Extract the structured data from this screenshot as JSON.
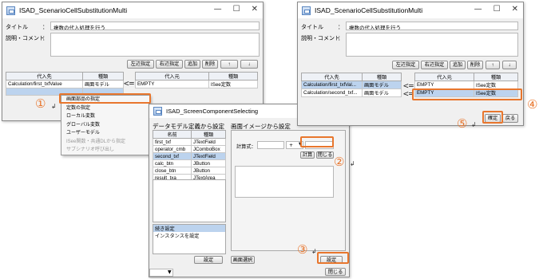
{
  "win1": {
    "title": "ISAD_ScenarioCellSubstitutionMulti",
    "title_label": "タイトル",
    "title_value": "複数の代入処理を行う",
    "comment_label": "説明・コメント",
    "colon": "：",
    "toolbar": [
      "左辺指定",
      "右辺指定",
      "追加",
      "削除",
      "↑",
      "↓"
    ],
    "left_headers": [
      "代入先",
      "種類"
    ],
    "left_rows": [
      [
        "Calculation/first_txfValue",
        "画面モデル"
      ]
    ],
    "right_headers": [
      "代入元",
      "種類"
    ],
    "right_rows": [
      [
        "EMPTY",
        "ISee定数"
      ]
    ],
    "assign_arrow": "<="
  },
  "context_menu": {
    "items": [
      "画面部品の指定",
      "定数の指定",
      "ローカル変数",
      "グローバル変数",
      "ユーザーモデル",
      "ISee関数・共通DLから指定",
      "サブシナリオ呼び出し"
    ]
  },
  "win2": {
    "title": "ISAD_ScreenComponentSelecting",
    "left_panel_title": "データモデル定義から設定",
    "list_headers": [
      "名前",
      "種類"
    ],
    "list_rows": [
      [
        "first_txf",
        "JTextField"
      ],
      [
        "operator_cmb",
        "JComboBox"
      ],
      [
        "second_txf",
        "JTextField"
      ],
      [
        "calc_btn",
        "JButton"
      ],
      [
        "close_btn",
        "JButton"
      ],
      [
        "result_txa",
        "JTextArea"
      ]
    ],
    "selected_index": 2,
    "lower_header": "続き設定",
    "lower_item": "インスタンスを設定",
    "set_label": "設定",
    "right_panel_title": "画面イメージから設定",
    "formula_label": "計算式：",
    "formula_value": "",
    "op_value": "+",
    "calc_btn": "計算",
    "close_btn": "閉じる",
    "screen_select_btn": "画面選択",
    "set_btn": "設定",
    "close_bottom_btn": "閉じる"
  },
  "win3": {
    "title": "ISAD_ScenarioCellSubstitutionMulti",
    "title_label": "タイトル",
    "title_value": "複数の代入処理を行う",
    "comment_label": "説明・コメント",
    "colon": "：",
    "toolbar": [
      "左辺指定",
      "右辺指定",
      "追加",
      "削除",
      "↑",
      "↓"
    ],
    "left_headers": [
      "代入先",
      "種類"
    ],
    "left_rows": [
      [
        "Calculation/first_txfVal...",
        "画面モデル"
      ],
      [
        "Calculation/second_txf...",
        "画面モデル"
      ]
    ],
    "right_headers": [
      "代入元",
      "種類"
    ],
    "right_rows": [
      [
        "EMPTY",
        "ISee定数"
      ],
      [
        "EMPTY",
        "ISee定数"
      ]
    ],
    "assign_arrow": "<=",
    "ok_btn": "確定",
    "back_btn": "戻る"
  },
  "callouts": [
    "①",
    "②",
    "③",
    "④",
    "⑤"
  ],
  "window_controls": [
    "—",
    "☐",
    "✕"
  ],
  "accent_color": "#e8762d",
  "selection_color": "#bcd3ee"
}
